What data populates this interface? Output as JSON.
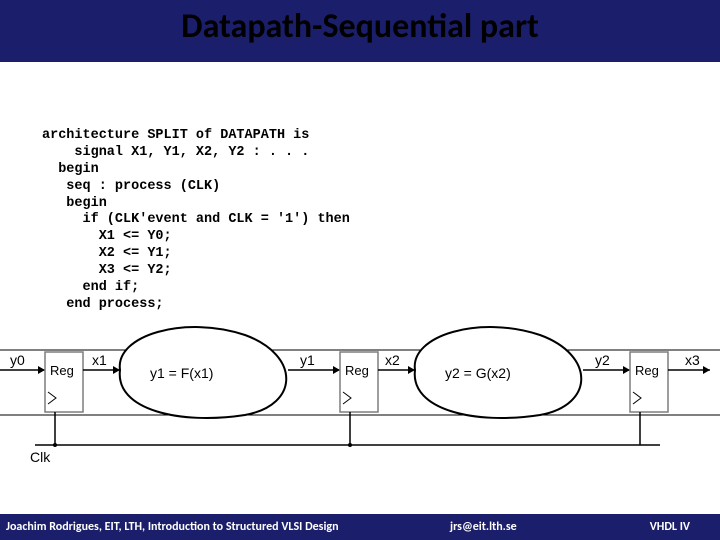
{
  "title": "Datapath-Sequential part",
  "code_lines": [
    "architecture SPLIT of DATAPATH is",
    "    signal X1, Y1, X2, Y2 : . . .",
    "  begin",
    "   seq : process (CLK)",
    "   begin",
    "     if (CLK'event and CLK = '1') then",
    "       X1 <= Y0;",
    "       X2 <= Y1;",
    "       X3 <= Y2;",
    "     end if;",
    "   end process;"
  ],
  "diagram": {
    "inputs": [
      "y0",
      "x1",
      "y1",
      "x2",
      "y2",
      "x3"
    ],
    "reg_label": "Reg",
    "f_label": "y1 = F(x1)",
    "g_label": "y2 = G(x2)",
    "clk": "Clk"
  },
  "footer": {
    "left": "Joachim Rodrigues, EIT, LTH, Introduction to Structured VLSI Design",
    "middle": "jrs@eit.lth.se",
    "right": "VHDL IV"
  }
}
